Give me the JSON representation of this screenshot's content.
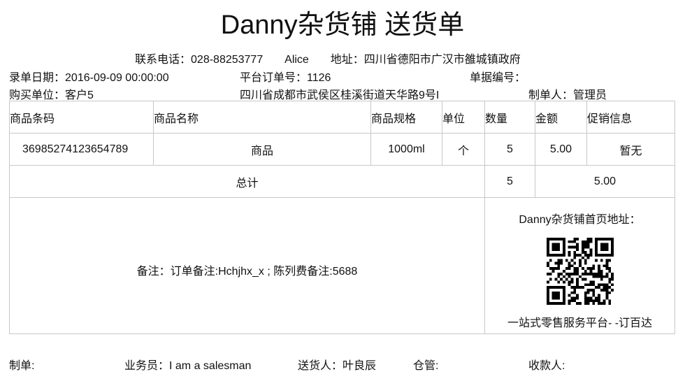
{
  "title": "Danny杂货铺 送货单",
  "contact": {
    "phone_label": "联系电话：",
    "phone": "028-88253777",
    "name": "Alice",
    "address_label": "地址：",
    "address": "四川省德阳市广汉市雒城镇政府"
  },
  "info": {
    "date_label": "录单日期：",
    "date": "2016-09-09 00:00:00",
    "order_label": "平台订单号：",
    "order_no": "1126",
    "doc_label": "单据编号：",
    "doc_no": "",
    "buyer_label": "购买单位：",
    "buyer": "客户5",
    "buyer_address": "四川省成都市武侯区桂溪街道天华路9号I",
    "maker_label": "制单人：",
    "maker": "管理员"
  },
  "table": {
    "headers": [
      "商品条码",
      "商品名称",
      "商品规格",
      "单位",
      "数量",
      "金额",
      "促销信息"
    ],
    "rows": [
      [
        "36985274123654789",
        "商品",
        "1000ml",
        "个",
        "5",
        "5.00",
        "暂无"
      ]
    ],
    "total_label": "总计",
    "total_qty": "5",
    "total_amount": "5.00",
    "remark": "备注：订单备注:Hchjhx_x ; 陈列费备注:5688",
    "homepage_label": "Danny杂货铺首页地址：",
    "platform_slogan": "一站式零售服务平台- -订百达"
  },
  "footer": {
    "maker": "制单:",
    "salesman_label": "业务员：",
    "salesman": "I am a salesman",
    "deliverer_label": "送货人：",
    "deliverer": "叶良辰",
    "warehouse": "仓管:",
    "payee": "收款人:"
  }
}
